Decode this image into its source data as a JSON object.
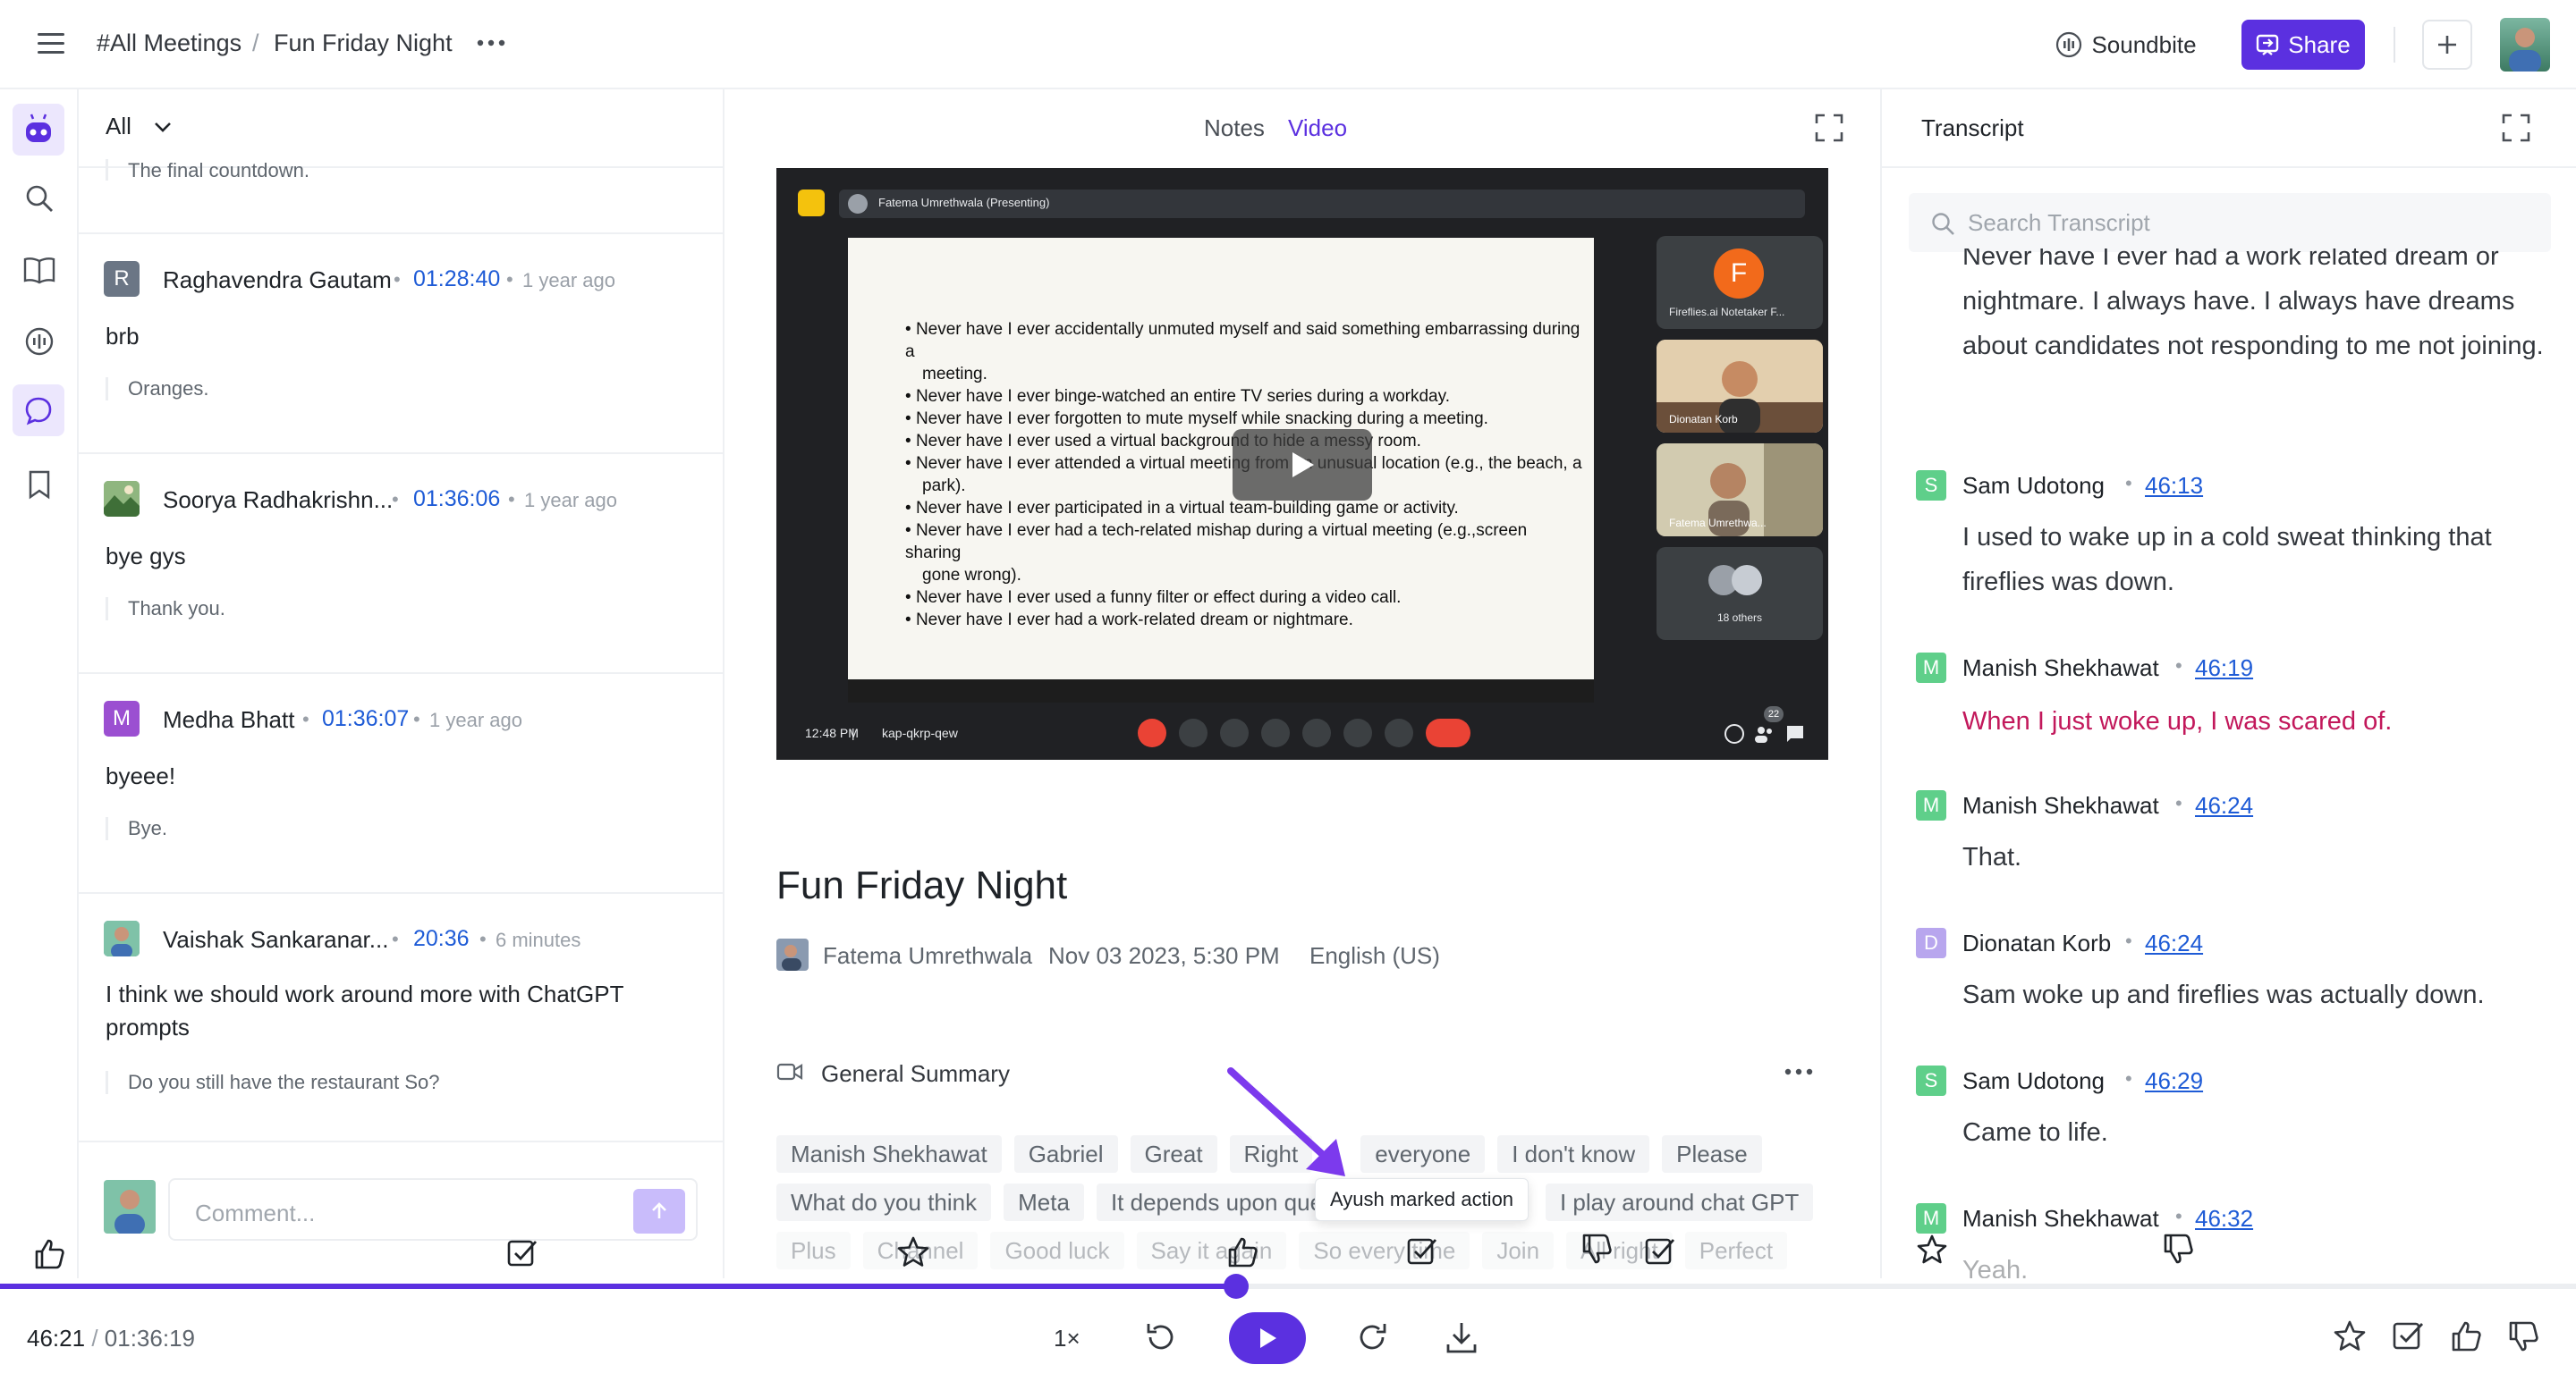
{
  "breadcrumb": {
    "parent": "#All Meetings",
    "separator": "/",
    "current": "Fun Friday Night"
  },
  "header": {
    "soundbite_label": "Soundbite",
    "share_label": "Share"
  },
  "comments": {
    "filter_label": "All",
    "top_cut_quote": "The final countdown.",
    "items": [
      {
        "initial": "R",
        "color": "#6b7685",
        "name": "Raghavendra Gautam",
        "time": "01:28:40",
        "ago": "1 year ago",
        "text": "brb",
        "quote": "Oranges."
      },
      {
        "initial": "",
        "color": "#5a8a4d",
        "name": "Soorya Radhakrishn...",
        "time": "01:36:06",
        "ago": "1 year ago",
        "text": "bye gys",
        "quote": "Thank you."
      },
      {
        "initial": "M",
        "color": "#9b4fd1",
        "name": "Medha Bhatt",
        "time": "01:36:07",
        "ago": "1 year ago",
        "text": "byeee!",
        "quote": "Bye."
      },
      {
        "initial": "",
        "color": "#4c8fa1",
        "name": "Vaishak Sankaranar...",
        "time": "20:36",
        "ago": "6 minutes",
        "text": "I think we should work around more with ChatGPT prompts",
        "quote": "Do you still have the restaurant So?"
      }
    ],
    "input_placeholder": "Comment..."
  },
  "center": {
    "tabs": [
      {
        "label": "Notes",
        "active": false
      },
      {
        "label": "Video",
        "active": true
      }
    ],
    "video": {
      "presenter_label": "Fatema Umrethwala (Presenting)",
      "slide_lines": [
        "Never have I ever accidentally unmuted myself and said something embarrassing during a",
        "meeting.",
        "Never have I ever binge-watched an entire TV series during a workday.",
        "Never have I ever forgotten to mute myself while snacking during a meeting.",
        "Never have I ever used a virtual background to hide a messy room.",
        "Never have I ever attended a virtual meeting from an unusual location (e.g., the beach, a",
        "park).",
        "Never have I ever participated in a virtual team-building game or activity.",
        "Never have I ever had a tech-related mishap during a virtual meeting (e.g.,screen sharing",
        "gone wrong).",
        "Never have I ever used a funny filter or effect during a video call.",
        "Never have I ever had a work-related dream or nightmare."
      ],
      "participants": [
        {
          "label": "Fireflies.ai Notetaker F...",
          "initial": "F"
        },
        {
          "label": "Dionatan Korb"
        },
        {
          "label": "Fatema Umrethwa..."
        },
        {
          "label": "18 others"
        }
      ],
      "clock": "12:48 PM",
      "meeting_code": "kap-qkrp-qew",
      "people_badge": "22"
    },
    "meeting": {
      "title": "Fun Friday Night",
      "host": "Fatema Umrethwala",
      "date": "Nov 03 2023, 5:30 PM",
      "language": "English (US)"
    },
    "summary_label": "General Summary",
    "chips_row1": [
      "Manish Shekhawat",
      "Gabriel",
      "Great",
      "Right",
      "everyone",
      "I don't know",
      "Please"
    ],
    "chips_row2": [
      "What do you think",
      "Meta",
      "It depends upon que",
      "I play around chat GPT"
    ],
    "chips_row3": [
      "Plus",
      "Channel",
      "Good luck",
      "Say it again",
      "So every time",
      "Join",
      "All right",
      "Perfect"
    ],
    "tooltip": "Ayush marked action"
  },
  "transcript": {
    "title": "Transcript",
    "search_placeholder": "Search Transcript",
    "lead_text": "Never have I ever had a work related dream or nightmare. I always have. I always have dreams about candidates not responding to me not joining.",
    "entries": [
      {
        "initial": "S",
        "color": "#5fcf8a",
        "name": "Sam Udotong",
        "time": "46:13",
        "text": "I used to wake up in a cold sweat thinking that fireflies was down.",
        "highlight": false
      },
      {
        "initial": "M",
        "color": "#5fcf8a",
        "name": "Manish Shekhawat",
        "time": "46:19",
        "text": "When I just woke up, I was scared of.",
        "highlight": true
      },
      {
        "initial": "M",
        "color": "#5fcf8a",
        "name": "Manish Shekhawat",
        "time": "46:24",
        "text": "That.",
        "highlight": false
      },
      {
        "initial": "D",
        "color": "#b8a6ee",
        "name": "Dionatan Korb",
        "time": "46:24",
        "text": "Sam woke up and fireflies was actually down.",
        "highlight": false
      },
      {
        "initial": "S",
        "color": "#5fcf8a",
        "name": "Sam Udotong",
        "time": "46:29",
        "text": "Came to life.",
        "highlight": false
      },
      {
        "initial": "M",
        "color": "#5fcf8a",
        "name": "Manish Shekhawat",
        "time": "46:32",
        "text": "Yeah.",
        "highlight": false
      }
    ]
  },
  "player": {
    "current": "46:21",
    "separator": "/",
    "total": "01:36:19",
    "speed": "1×",
    "progress": 0.48
  },
  "colors": {
    "accent": "#5b30e0",
    "link": "#1e5bd6",
    "highlight_text": "#c2185b"
  }
}
